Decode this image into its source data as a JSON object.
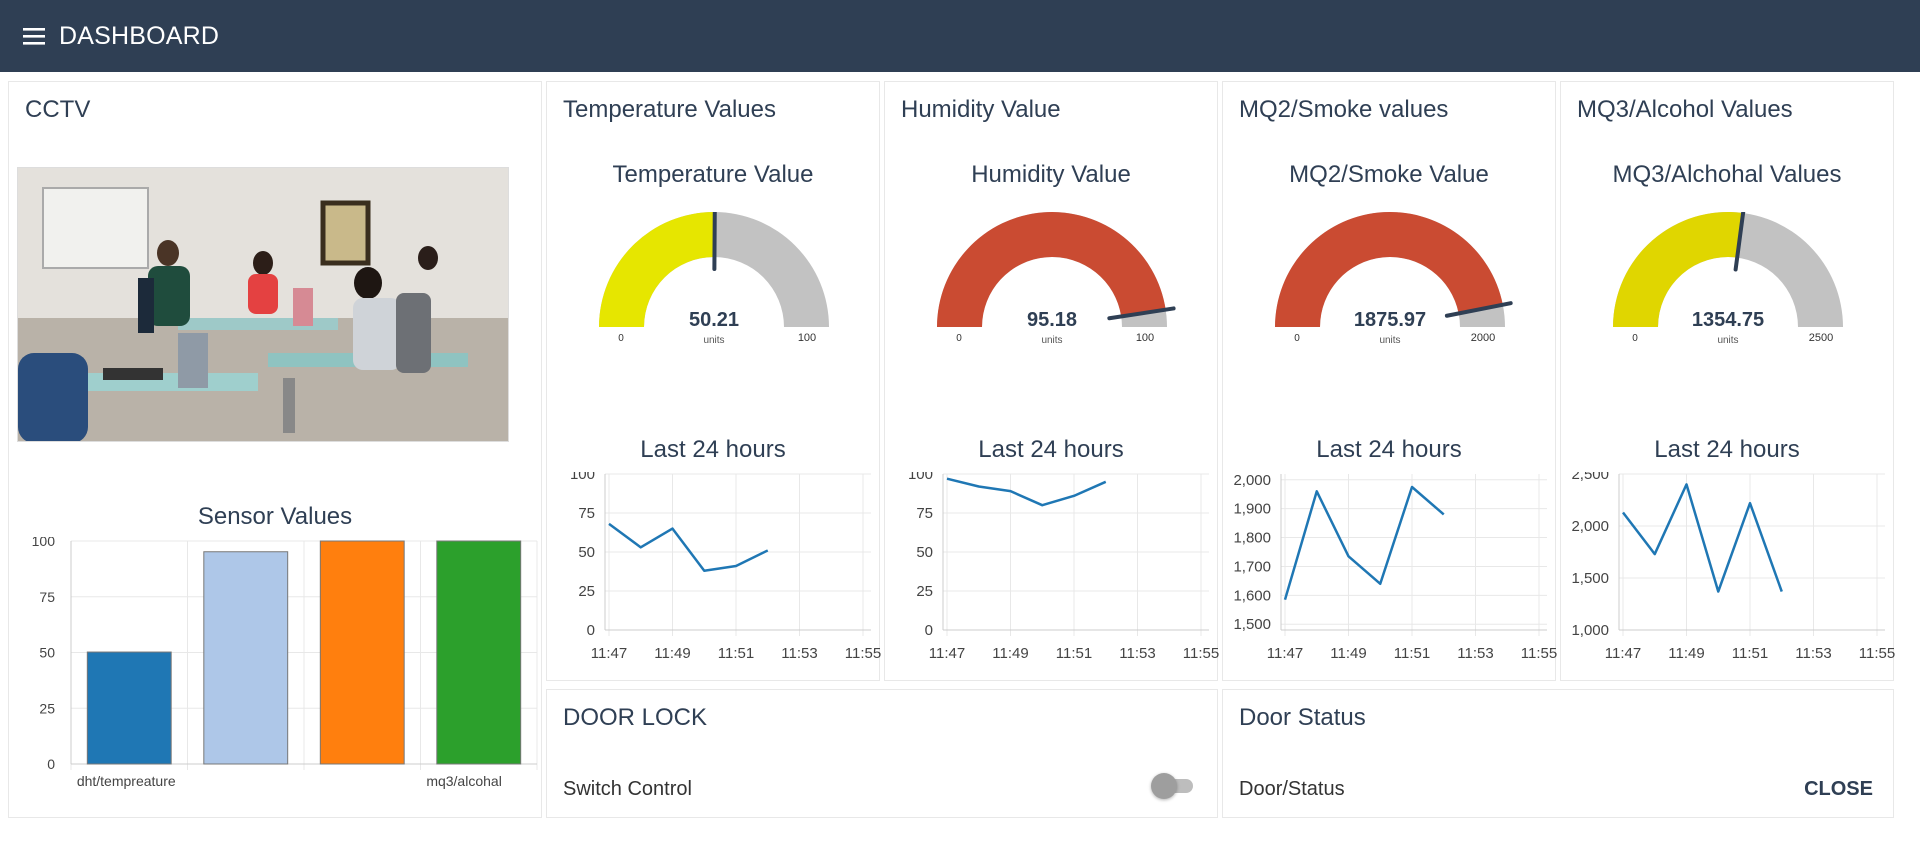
{
  "header": {
    "title": "DASHBOARD",
    "menu_icon": "hamburger-icon",
    "background": "#2f3f54"
  },
  "cctv": {
    "title": "CCTV",
    "image_subject": "classroom-photo"
  },
  "sensor_values": {
    "title": "Sensor Values",
    "chart_data": {
      "type": "bar",
      "title": "Sensor Values",
      "categories": [
        "dht/tempreature",
        "",
        "",
        "mq3/alcohal"
      ],
      "visible_category_labels": [
        "dht/tempreature",
        "mq3/alcohal"
      ],
      "values": [
        50.21,
        95.18,
        100,
        100
      ],
      "colors": [
        "#1f77b4",
        "#aec7e8",
        "#ff7f0e",
        "#2ca02c"
      ],
      "ylim": [
        0,
        100
      ],
      "yticks": [
        "100",
        "75",
        "50",
        "25",
        "0"
      ],
      "grid": true
    }
  },
  "temperature": {
    "card_title": "Temperature Values",
    "gauge": {
      "title": "Temperature Value",
      "value": 50.21,
      "value_text": "50.21",
      "units": "units",
      "min": 0,
      "max": 100,
      "min_label": "0",
      "max_label": "100",
      "color": "#e6e600"
    },
    "history_title": "Last 24 hours",
    "chart_data": {
      "type": "line",
      "x": [
        "11:47",
        "11:48",
        "11:49",
        "11:50",
        "11:51",
        "11:52"
      ],
      "values": [
        68,
        53,
        65,
        38,
        41,
        51
      ],
      "xticks": [
        "11:47",
        "11:49",
        "11:51",
        "11:53",
        "11:55"
      ],
      "ylim": [
        0,
        100
      ],
      "yticks": [
        "100",
        "75",
        "50",
        "25",
        "0"
      ],
      "color": "#1f77b4",
      "grid": true
    }
  },
  "humidity": {
    "card_title": "Humidity Value",
    "gauge": {
      "title": "Humidity Value",
      "value": 95.18,
      "value_text": "95.18",
      "units": "units",
      "min": 0,
      "max": 100,
      "min_label": "0",
      "max_label": "100",
      "color": "#ca4b32"
    },
    "history_title": "Last 24 hours",
    "chart_data": {
      "type": "line",
      "x": [
        "11:47",
        "11:48",
        "11:49",
        "11:50",
        "11:51",
        "11:52"
      ],
      "values": [
        97,
        92,
        89,
        80,
        86,
        95
      ],
      "xticks": [
        "11:47",
        "11:49",
        "11:51",
        "11:53",
        "11:55"
      ],
      "ylim": [
        0,
        100
      ],
      "yticks": [
        "100",
        "75",
        "50",
        "25",
        "0"
      ],
      "color": "#1f77b4",
      "grid": true
    }
  },
  "smoke": {
    "card_title": "MQ2/Smoke values",
    "gauge": {
      "title": "MQ2/Smoke Value",
      "value": 1875.97,
      "value_text": "1875.97",
      "units": "units",
      "min": 0,
      "max": 2000,
      "min_label": "0",
      "max_label": "2000",
      "color": "#ca4b32"
    },
    "history_title": "Last 24 hours",
    "chart_data": {
      "type": "line",
      "x": [
        "11:47",
        "11:48",
        "11:49",
        "11:50",
        "11:51",
        "11:52"
      ],
      "values": [
        1585,
        1960,
        1735,
        1640,
        1975,
        1880
      ],
      "xticks": [
        "11:47",
        "11:49",
        "11:51",
        "11:53",
        "11:55"
      ],
      "ylim": [
        1480,
        2020
      ],
      "ytick_values": [
        2000,
        1900,
        1800,
        1700,
        1600,
        1500
      ],
      "yticks": [
        "2,000",
        "1,900",
        "1,800",
        "1,700",
        "1,600",
        "1,500"
      ],
      "color": "#1f77b4",
      "grid": true
    }
  },
  "alcohol": {
    "card_title": "MQ3/Alcohol Values",
    "gauge": {
      "title": "MQ3/Alchohal Values",
      "value": 1354.75,
      "value_text": "1354.75",
      "units": "units",
      "min": 0,
      "max": 2500,
      "min_label": "0",
      "max_label": "2500",
      "color": "#e0d600"
    },
    "history_title": "Last 24 hours",
    "chart_data": {
      "type": "line",
      "x": [
        "11:47",
        "11:48",
        "11:49",
        "11:50",
        "11:51",
        "11:52"
      ],
      "values": [
        2130,
        1730,
        2400,
        1370,
        2220,
        1370
      ],
      "xticks": [
        "11:47",
        "11:49",
        "11:51",
        "11:53",
        "11:55"
      ],
      "ylim": [
        1000,
        2500
      ],
      "ytick_values": [
        2500,
        2000,
        1500,
        1000
      ],
      "yticks": [
        "2,500",
        "2,000",
        "1,500",
        "1,000"
      ],
      "color": "#1f77b4",
      "grid": true
    }
  },
  "door_lock": {
    "title": "DOOR LOCK",
    "switch_label": "Switch Control",
    "switch_on": false
  },
  "door_status": {
    "title": "Door Status",
    "label": "Door/Status",
    "value": "CLOSE"
  }
}
